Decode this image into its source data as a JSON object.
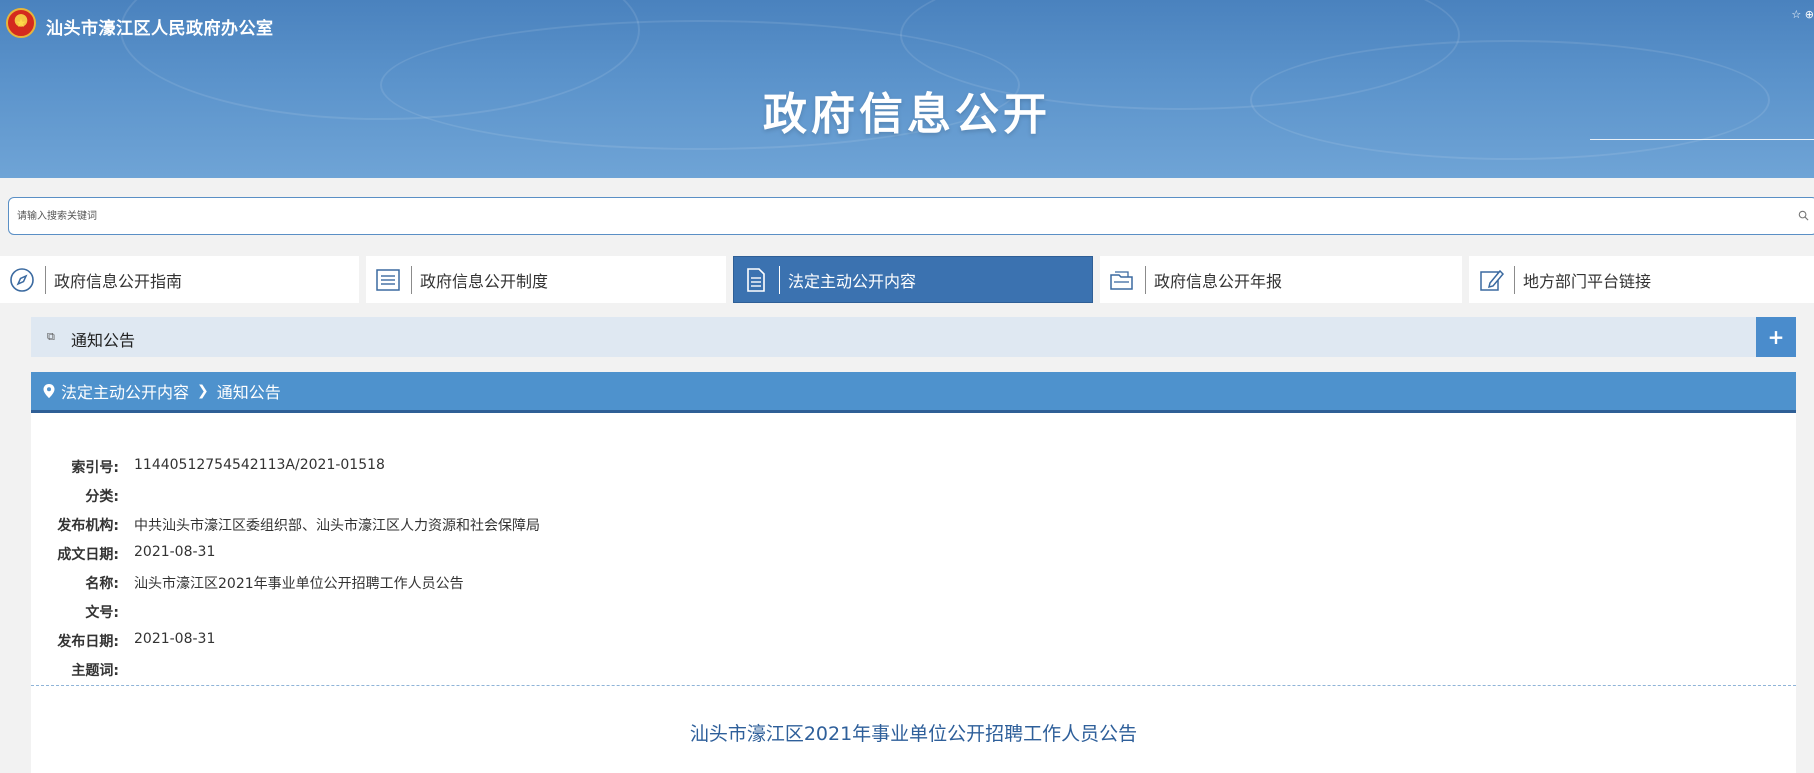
{
  "header": {
    "org_name": "汕头市濠江区人民政府办公室",
    "title": "政府信息公开",
    "corner_text": "☆ ⊕"
  },
  "search": {
    "placeholder": "请输入搜索关键词"
  },
  "tabs": [
    {
      "label": "政府信息公开指南",
      "icon": "compass-icon",
      "active": false
    },
    {
      "label": "政府信息公开制度",
      "icon": "list-icon",
      "active": false
    },
    {
      "label": "法定主动公开内容",
      "icon": "document-icon",
      "active": true
    },
    {
      "label": "政府信息公开年报",
      "icon": "folder-icon",
      "active": false
    },
    {
      "label": "地方部门平台链接",
      "icon": "edit-link-icon",
      "active": false
    }
  ],
  "section": {
    "title": "通知公告",
    "expand_label": "+"
  },
  "breadcrumb": {
    "items": [
      "法定主动公开内容",
      "通知公告"
    ]
  },
  "meta": [
    {
      "key": "索引号:",
      "value": "11440512754542113A/2021-01518"
    },
    {
      "key": "分类:",
      "value": ""
    },
    {
      "key": "发布机构:",
      "value": "中共汕头市濠江区委组织部、汕头市濠江区人力资源和社会保障局"
    },
    {
      "key": "成文日期:",
      "value": "2021-08-31"
    },
    {
      "key": "名称:",
      "value": "汕头市濠江区2021年事业单位公开招聘工作人员公告"
    },
    {
      "key": "文号:",
      "value": ""
    },
    {
      "key": "发布日期:",
      "value": "2021-08-31"
    },
    {
      "key": "主题词:",
      "value": ""
    }
  ],
  "document": {
    "title": "汕头市濠江区2021年事业单位公开招聘工作人员公告"
  },
  "colors": {
    "banner": "#5b93cb",
    "active_tab": "#3b72b0",
    "breadcrumb": "#4e92cd",
    "section_bar": "#dfe8f2",
    "doc_title": "#2e5f9a"
  }
}
